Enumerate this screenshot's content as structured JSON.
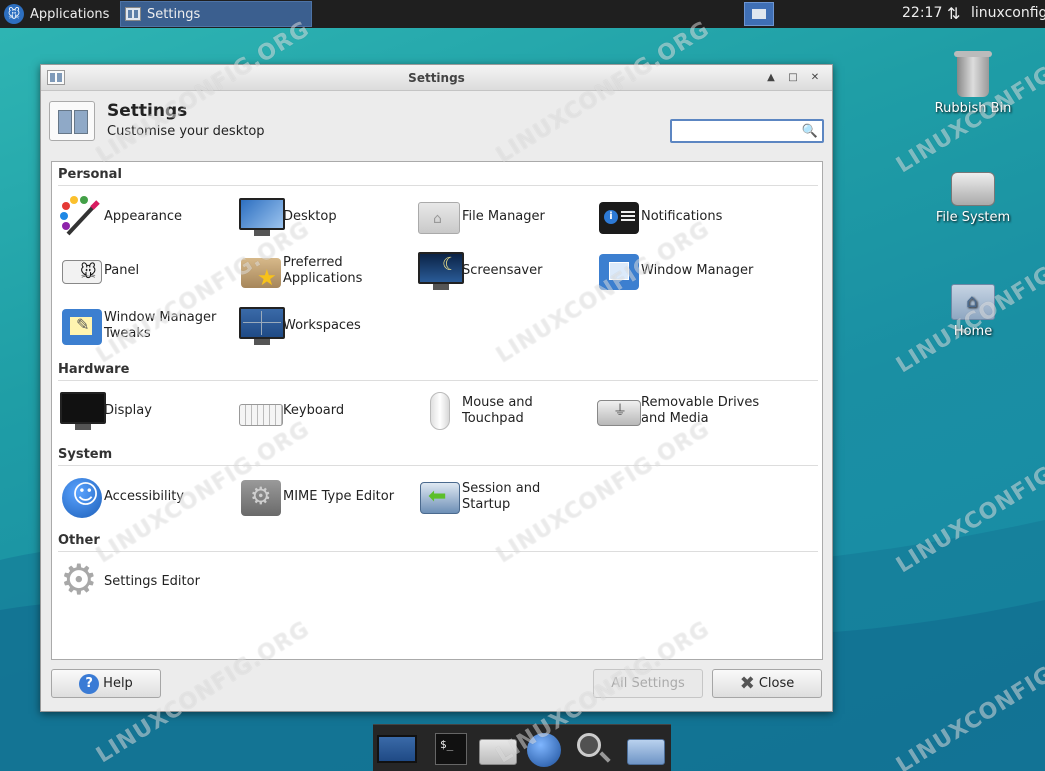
{
  "top_panel": {
    "applications_label": "Applications",
    "task_label": "Settings",
    "clock": "22:17",
    "user": "linuxconfig"
  },
  "desktop_icons": {
    "rubbish_bin": "Rubbish Bin",
    "file_system": "File System",
    "home": "Home"
  },
  "window": {
    "title": "Settings",
    "header_title": "Settings",
    "header_subtitle": "Customise your desktop",
    "search_value": "",
    "sections": {
      "personal": "Personal",
      "hardware": "Hardware",
      "system": "System",
      "other": "Other"
    },
    "items": {
      "appearance": "Appearance",
      "desktop": "Desktop",
      "file_manager": "File Manager",
      "notifications": "Notifications",
      "panel": "Panel",
      "preferred_apps_1": "Preferred",
      "preferred_apps_2": "Applications",
      "screensaver": "Screensaver",
      "window_manager": "Window Manager",
      "wm_tweaks_1": "Window Manager",
      "wm_tweaks_2": "Tweaks",
      "workspaces": "Workspaces",
      "display": "Display",
      "keyboard": "Keyboard",
      "mouse_1": "Mouse and",
      "mouse_2": "Touchpad",
      "removable_1": "Removable Drives",
      "removable_2": "and Media",
      "accessibility": "Accessibility",
      "mime": "MIME Type Editor",
      "session_1": "Session and",
      "session_2": "Startup",
      "settings_editor": "Settings Editor"
    },
    "buttons": {
      "help": "Help",
      "all_settings": "All Settings",
      "close": "Close"
    }
  },
  "watermark": "LINUXCONFIG.ORG",
  "colors": {
    "accent": "#3a7bd5",
    "desktop_bg": "#1f9ea6"
  }
}
